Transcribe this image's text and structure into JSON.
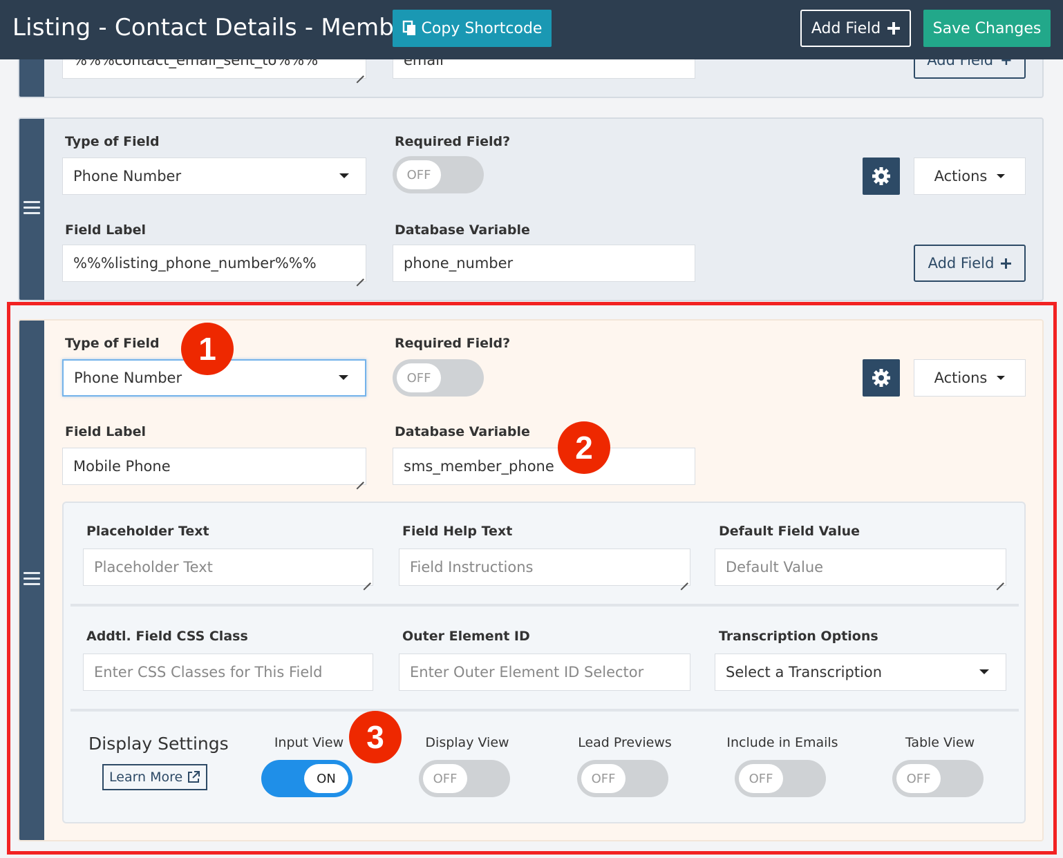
{
  "header": {
    "title": "Listing - Contact Details - Member",
    "copy_shortcode": "Copy Shortcode",
    "add_field": "Add Field",
    "save_changes": "Save Changes"
  },
  "card_top_partial": {
    "field_label_value": "%%%contact_email_sent_to%%%",
    "database_variable_value": "email",
    "add_field": "Add Field"
  },
  "card_phone": {
    "type_label": "Type of Field",
    "type_value": "Phone Number",
    "required_label": "Required Field?",
    "required_state": "OFF",
    "actions": "Actions",
    "field_label_label": "Field Label",
    "field_label_value": "%%%listing_phone_number%%%",
    "db_var_label": "Database Variable",
    "db_var_value": "phone_number",
    "add_field": "Add Field"
  },
  "card_mobile": {
    "type_label": "Type of Field",
    "type_value": "Phone Number",
    "required_label": "Required Field?",
    "required_state": "OFF",
    "actions": "Actions",
    "field_label_label": "Field Label",
    "field_label_value": "Mobile Phone",
    "db_var_label": "Database Variable",
    "db_var_value": "sms_member_phone",
    "settings": {
      "placeholder_label": "Placeholder Text",
      "placeholder_ph": "Placeholder Text",
      "help_label": "Field Help Text",
      "help_ph": "Field Instructions",
      "default_label": "Default Field Value",
      "default_ph": "Default Value",
      "css_label": "Addtl. Field CSS Class",
      "css_ph": "Enter CSS Classes for This Field",
      "outer_label": "Outer Element ID",
      "outer_ph": "Enter Outer Element ID Selector",
      "transcription_label": "Transcription Options",
      "transcription_value": "Select a Transcription"
    },
    "display": {
      "title": "Display Settings",
      "learn_more": "Learn More",
      "input_view": "Input View",
      "input_view_state": "ON",
      "display_view": "Display View",
      "display_view_state": "OFF",
      "lead_previews": "Lead Previews",
      "lead_previews_state": "OFF",
      "include_emails": "Include in Emails",
      "include_emails_state": "OFF",
      "table_view": "Table View",
      "table_view_state": "OFF"
    }
  },
  "annotations": [
    "1",
    "2",
    "3"
  ],
  "colors": {
    "topbar": "#2d3e50",
    "copy_button": "#1a98b3",
    "save_button": "#22a88a",
    "highlight": "#f22222",
    "badge": "#ee2800",
    "toggle_on": "#1f8fe8"
  }
}
